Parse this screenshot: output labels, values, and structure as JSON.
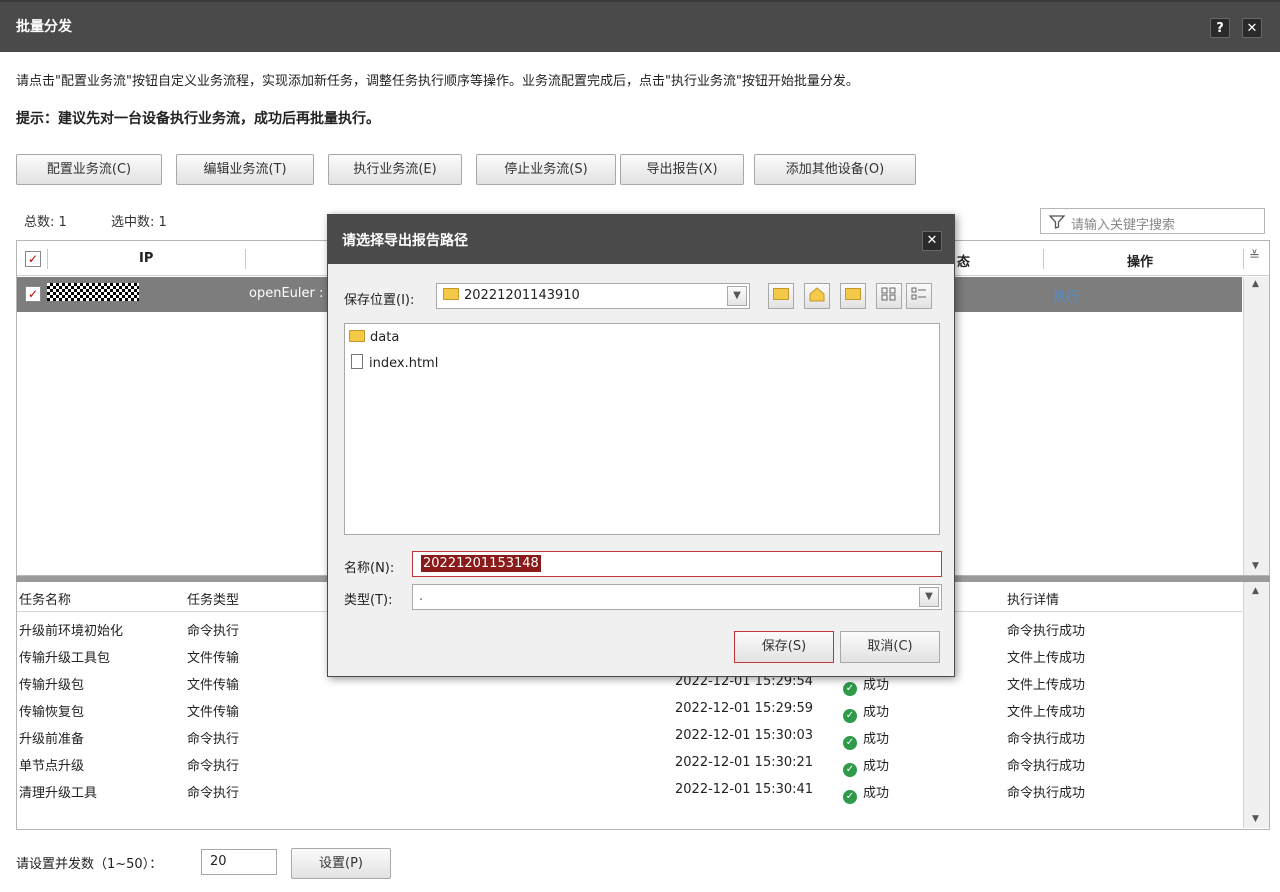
{
  "window": {
    "title": "批量分发",
    "help": "?",
    "close": "✕"
  },
  "intro": "请点击\"配置业务流\"按钮自定义业务流程，实现添加新任务，调整任务执行顺序等操作。业务流配置完成后，点击\"执行业务流\"按钮开始批量分发。",
  "tip": "提示：建议先对一台设备执行业务流，成功后再批量执行。",
  "toolbar": {
    "configure": "配置业务流(C)",
    "edit": "编辑业务流(T)",
    "execute": "执行业务流(E)",
    "stop": "停止业务流(S)",
    "export": "导出报告(X)",
    "add_devices": "添加其他设备(O)"
  },
  "counts": {
    "total": "总数: 1",
    "selected": "选中数: 1"
  },
  "search": {
    "placeholder": "请输入关键字搜索"
  },
  "device_table": {
    "headers": {
      "ip": "IP",
      "status": "态",
      "action": "操作"
    },
    "rows": [
      {
        "os": "openEuler :",
        "action": "执行"
      }
    ]
  },
  "task_table": {
    "headers": {
      "name": "任务名称",
      "type": "任务类型",
      "detail": "执行详情"
    },
    "rows": [
      {
        "name": "升级前环境初始化",
        "type": "命令执行",
        "time": "",
        "status": "",
        "detail": "命令执行成功"
      },
      {
        "name": "传输升级工具包",
        "type": "文件传输",
        "time": "",
        "status": "",
        "detail": "文件上传成功"
      },
      {
        "name": "传输升级包",
        "type": "文件传输",
        "time": "2022-12-01 15:29:54",
        "status": "成功",
        "detail": "文件上传成功"
      },
      {
        "name": "传输恢复包",
        "type": "文件传输",
        "time": "2022-12-01 15:29:59",
        "status": "成功",
        "detail": "文件上传成功"
      },
      {
        "name": "升级前准备",
        "type": "命令执行",
        "time": "2022-12-01 15:30:03",
        "status": "成功",
        "detail": "命令执行成功"
      },
      {
        "name": "单节点升级",
        "type": "命令执行",
        "time": "2022-12-01 15:30:21",
        "status": "成功",
        "detail": "命令执行成功"
      },
      {
        "name": "清理升级工具",
        "type": "命令执行",
        "time": "2022-12-01 15:30:41",
        "status": "成功",
        "detail": "命令执行成功"
      }
    ]
  },
  "concurrency": {
    "label": "请设置并发数（1~50）：",
    "value": "20",
    "button": "设置(P)"
  },
  "dialog": {
    "title": "请选择导出报告路径",
    "close": "✕",
    "save_in_label": "保存位置(I):",
    "save_in_value": "20221201143910",
    "files": [
      {
        "name": "data",
        "kind": "folder"
      },
      {
        "name": "index.html",
        "kind": "file"
      }
    ],
    "name_label": "名称(N):",
    "name_value": "20221201153148",
    "type_label": "类型(T):",
    "type_value": ".",
    "save_button": "保存(S)",
    "cancel_button": "取消(C)"
  },
  "colors": {
    "titlebar": "#4a4a4a",
    "row_selected": "#7d7d7d",
    "accent_red": "#c0353a",
    "success": "#2e9a4a",
    "link": "#4a90d9"
  }
}
